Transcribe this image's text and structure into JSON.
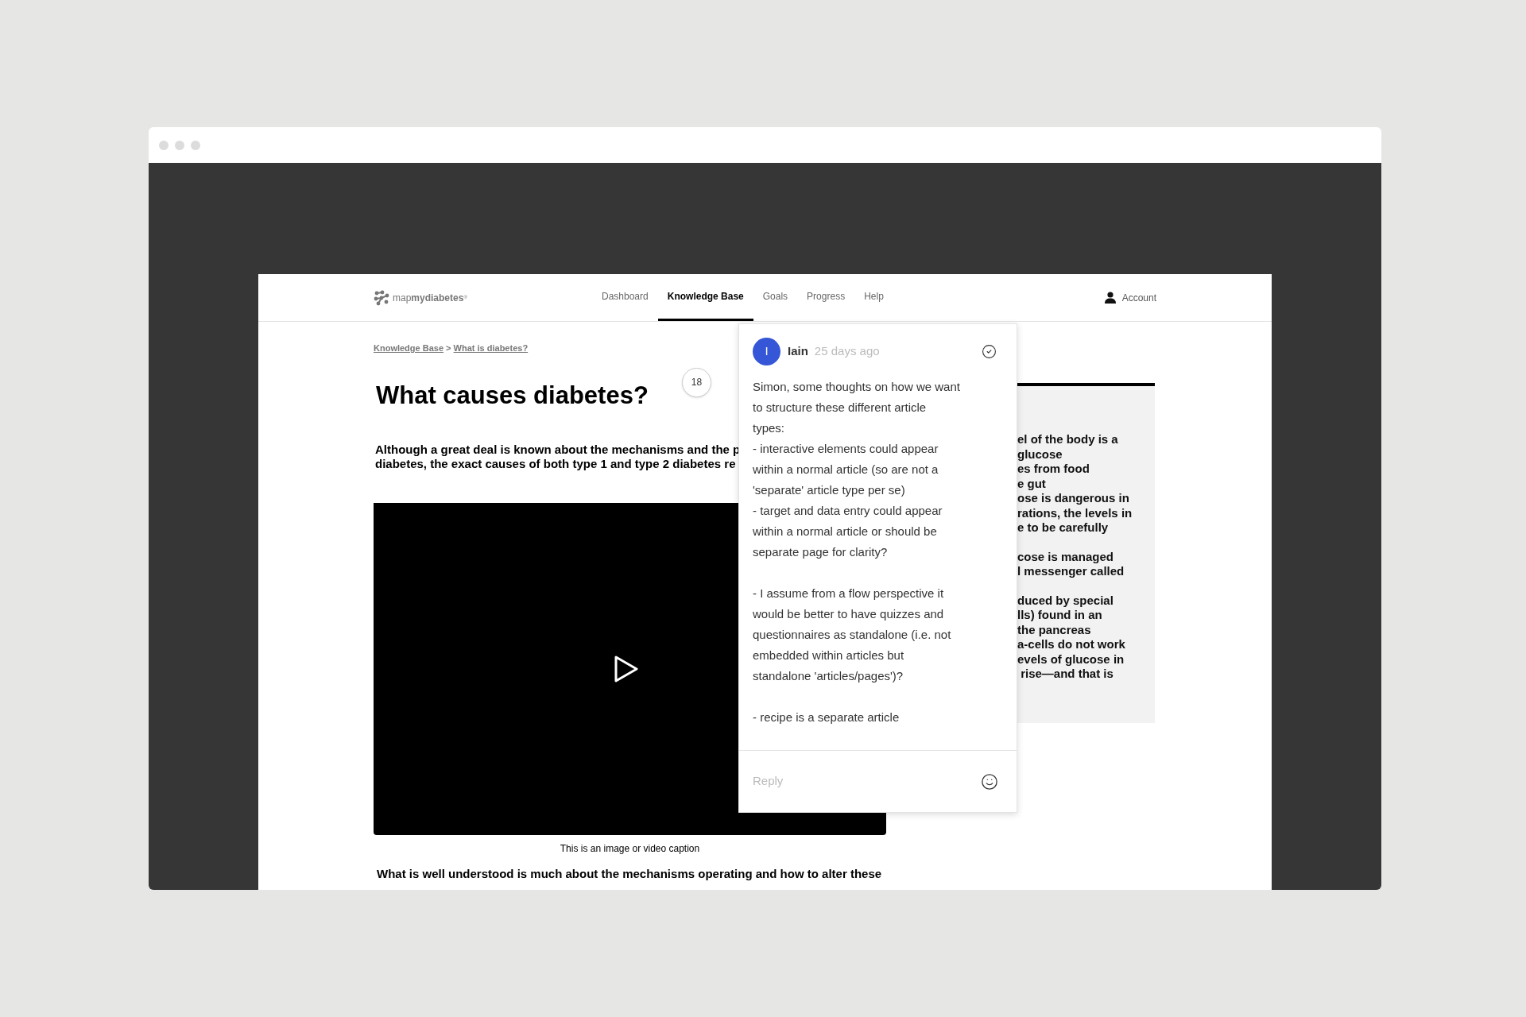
{
  "logo": {
    "prefix": "map",
    "name": "mydiabetes",
    "mark": "®"
  },
  "nav": [
    {
      "label": "Dashboard",
      "selected": false
    },
    {
      "label": "Knowledge Base",
      "selected": true
    },
    {
      "label": "Goals",
      "selected": false
    },
    {
      "label": "Progress",
      "selected": false
    },
    {
      "label": "Help",
      "selected": false
    }
  ],
  "account": {
    "label": "Account"
  },
  "breadcrumb": [
    {
      "label": "Knowledge Base"
    },
    {
      "label": "What is diabetes?"
    }
  ],
  "breadcrumb_separator": ">",
  "article": {
    "title": "What causes diabetes?",
    "comment_count": "18",
    "intro": [
      "Although a great deal is known about the mechanisms and the p",
      "diabetes, the exact causes of both type 1 and type 2 diabetes re"
    ],
    "caption": "This is an image or video caption",
    "next_paragraph": "What is well understood is much about the mechanisms operating and how to alter these"
  },
  "sidebox": {
    "paragraphs": [
      [
        "el of the body is a",
        "glucose",
        "es from food",
        "e gut",
        "ose is dangerous in",
        "rations, the levels in",
        "e to be carefully"
      ],
      [
        "cose is managed",
        "l messenger called"
      ],
      [
        "duced by special",
        "lls) found in an",
        "the pancreas",
        "a-cells do not work",
        "evels of glucose in",
        " rise—and that is"
      ]
    ]
  },
  "comment": {
    "initial": "I",
    "author": "Iain",
    "time": "25 days ago",
    "resolved": false,
    "paragraphs": [
      [
        "Simon, some thoughts on how we want",
        "to structure these different article",
        "types:",
        "- interactive elements could appear",
        "within a normal article (so are not a",
        "'separate' article type per se)",
        "- target and data entry could appear",
        "within a normal article or should be",
        "separate page for clarity?"
      ],
      [
        "- I assume from a flow perspective it",
        "would be better to have quizzes and",
        "questionnaires as standalone (i.e. not",
        "embedded within articles but",
        "standalone 'articles/pages')?"
      ],
      [
        "- recipe is a separate article"
      ]
    ],
    "reply": {
      "placeholder": "Reply"
    }
  }
}
